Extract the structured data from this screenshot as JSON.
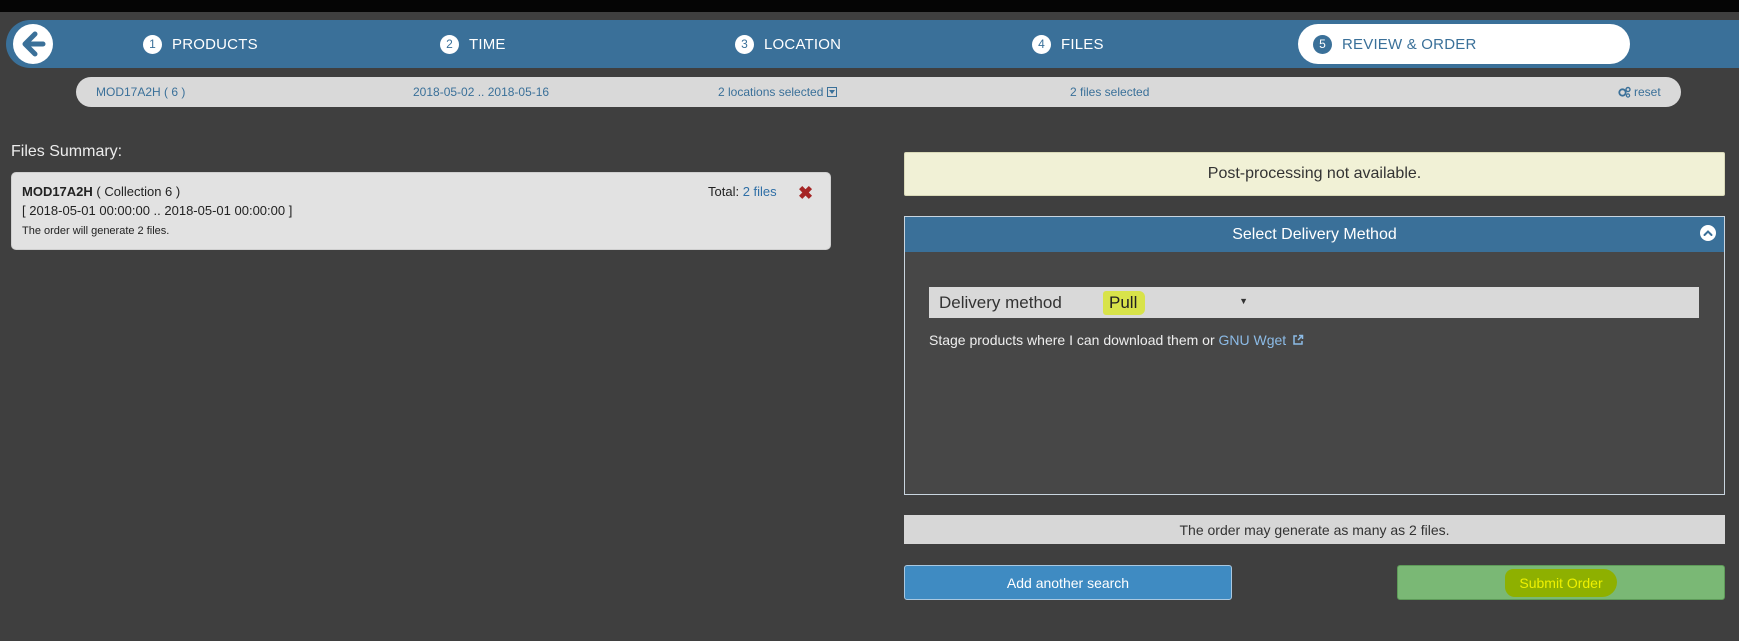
{
  "stepper": {
    "steps": [
      {
        "num": "1",
        "label": "PRODUCTS"
      },
      {
        "num": "2",
        "label": "TIME"
      },
      {
        "num": "3",
        "label": "LOCATION"
      },
      {
        "num": "4",
        "label": "FILES"
      },
      {
        "num": "5",
        "label": "REVIEW & ORDER"
      }
    ],
    "active_step": 5
  },
  "summary_bar": {
    "product": "MOD17A2H ( 6 )",
    "date_range": "2018-05-02 .. 2018-05-16",
    "locations": "2 locations selected",
    "files": "2 files selected",
    "reset": "reset"
  },
  "files_summary": {
    "title": "Files Summary:",
    "product_name": "MOD17A2H",
    "collection": " ( Collection 6 )",
    "date_range": "[ 2018-05-01 00:00:00 .. 2018-05-01 00:00:00 ]",
    "note": "The order will generate 2 files.",
    "total_label": "Total: ",
    "total_link": "2 files",
    "remove_icon": "✖"
  },
  "post_processing": {
    "message": "Post-processing not available."
  },
  "delivery": {
    "header": "Select Delivery Method",
    "label": "Delivery method",
    "selected": "Pull",
    "description": "Stage products where I can download them or ",
    "link": "GNU Wget"
  },
  "order_note": "The order may generate as many as 2 files.",
  "buttons": {
    "add_search": "Add another search",
    "submit": "Submit Order"
  },
  "colors": {
    "primary": "#3a7099",
    "highlight": "#d8e34a",
    "submit": "#7ab875"
  }
}
